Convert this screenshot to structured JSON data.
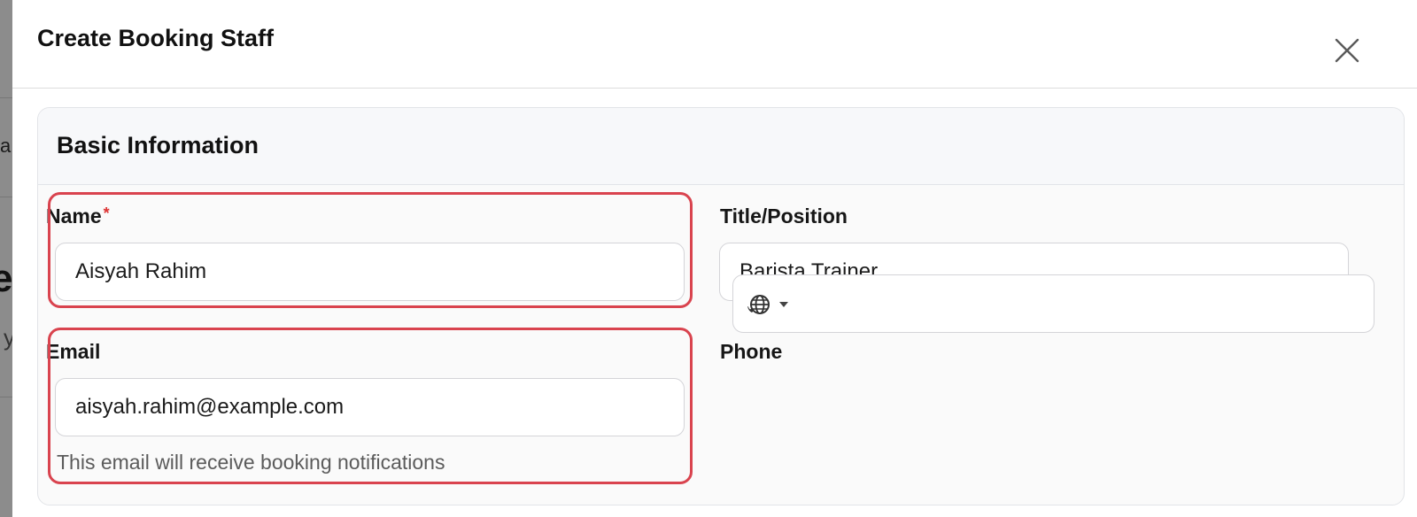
{
  "modal": {
    "title": "Create Booking Staff"
  },
  "section": {
    "title": "Basic Information"
  },
  "fields": {
    "name": {
      "label": "Name",
      "required_mark": "*",
      "value": "Aisyah Rahim"
    },
    "title_position": {
      "label": "Title/Position",
      "value": "Barista Trainer"
    },
    "email": {
      "label": "Email",
      "value": "aisyah.rahim@example.com",
      "help": "This email will receive booking notifications"
    },
    "phone": {
      "label": "Phone",
      "value": "",
      "country_icon": "globe-phone-icon"
    }
  },
  "background": {
    "fragment_a": "a",
    "fragment_e": "e",
    "fragment_y": "y"
  },
  "colors": {
    "highlight": "#d9434e",
    "required": "#dd3333"
  }
}
